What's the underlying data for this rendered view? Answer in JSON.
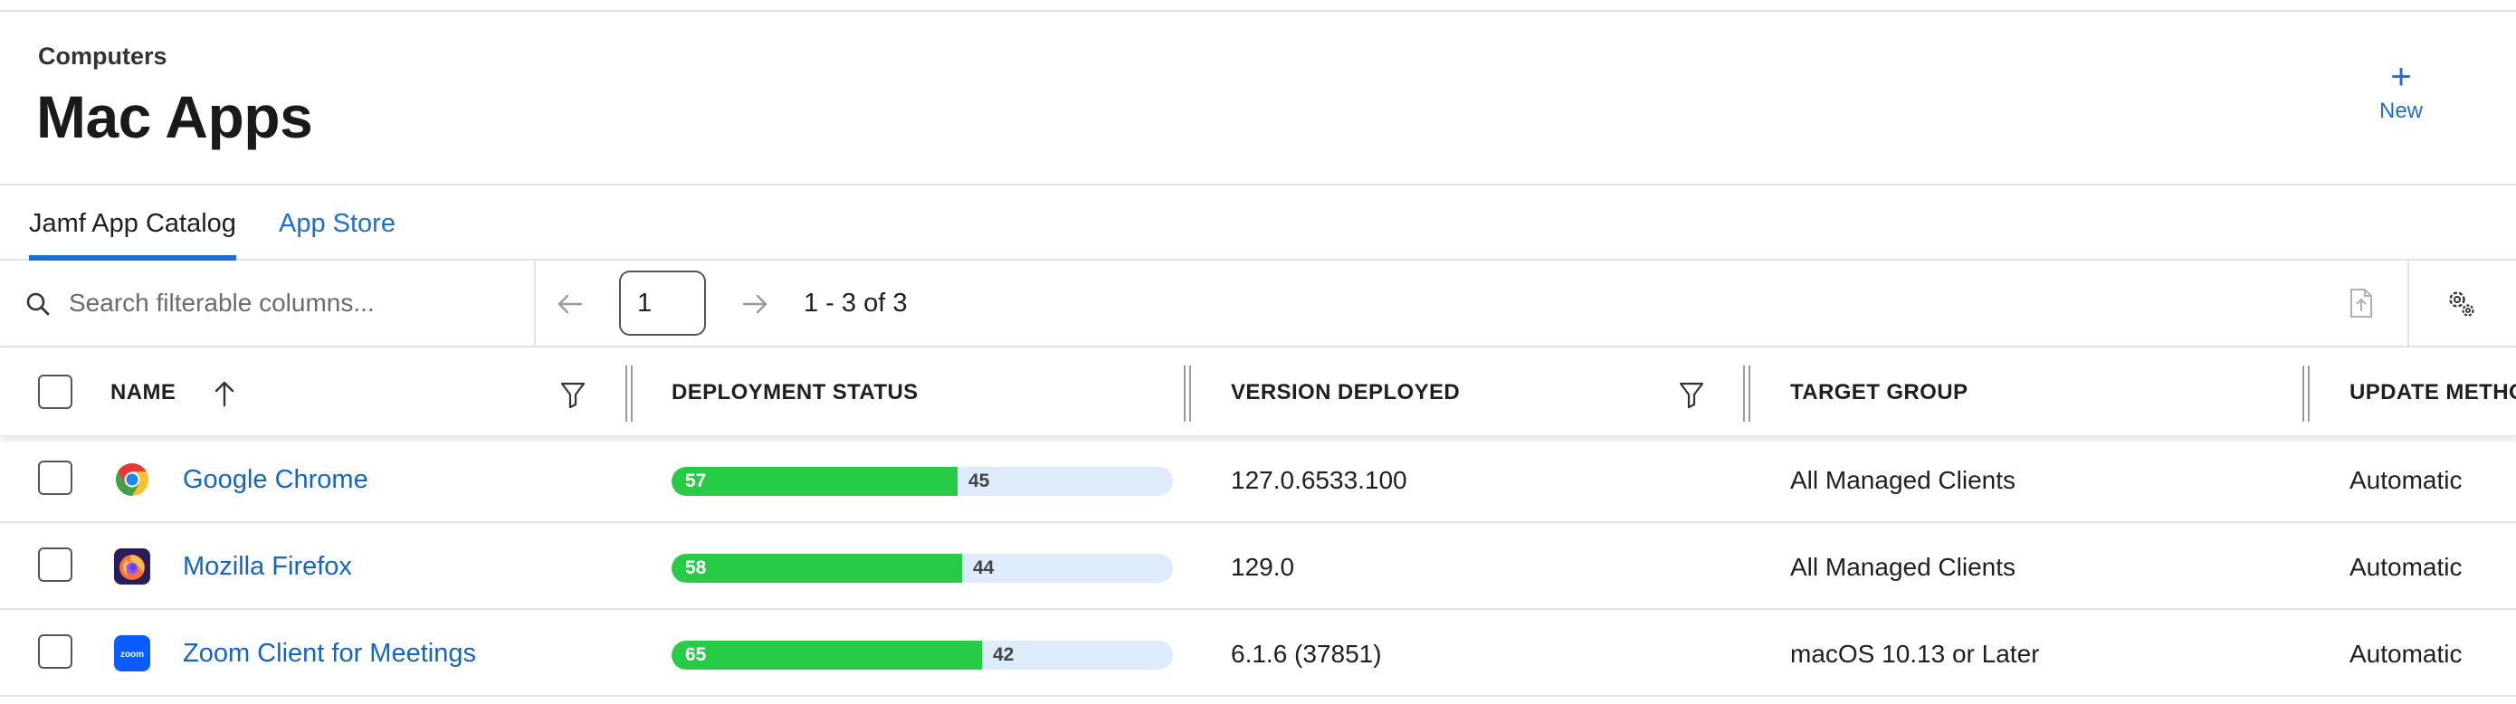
{
  "header": {
    "breadcrumb": "Computers",
    "title": "Mac Apps",
    "new_label": "New",
    "new_icon": "plus-icon"
  },
  "tabs": [
    {
      "label": "Jamf App Catalog",
      "active": true
    },
    {
      "label": "App Store",
      "active": false
    }
  ],
  "toolbar": {
    "search_placeholder": "Search filterable columns...",
    "search_value": "",
    "page_value": "1",
    "range_text": "1 - 3 of 3"
  },
  "columns": [
    {
      "label": "NAME"
    },
    {
      "label": "DEPLOYMENT STATUS"
    },
    {
      "label": "VERSION DEPLOYED"
    },
    {
      "label": "TARGET GROUP"
    },
    {
      "label": "UPDATE METHO"
    }
  ],
  "rows": [
    {
      "name": "Google Chrome",
      "icon": "chrome-icon",
      "deployed": 57,
      "pending": 45,
      "version": "127.0.6533.100",
      "target_group": "All Managed Clients",
      "update_method": "Automatic"
    },
    {
      "name": "Mozilla Firefox",
      "icon": "firefox-icon",
      "deployed": 58,
      "pending": 44,
      "version": "129.0",
      "target_group": "All Managed Clients",
      "update_method": "Automatic"
    },
    {
      "name": "Zoom Client for Meetings",
      "icon": "zoom-icon",
      "icon_text": "zoom",
      "deployed": 65,
      "pending": 42,
      "version": "6.1.6 (37851)",
      "target_group": "macOS 10.13 or Later",
      "update_method": "Automatic"
    }
  ],
  "colors": {
    "accent": "#1e6ed1",
    "deployed_bar": "#27cb45",
    "pending_bar": "#deebfb",
    "link": "#1565c0"
  }
}
